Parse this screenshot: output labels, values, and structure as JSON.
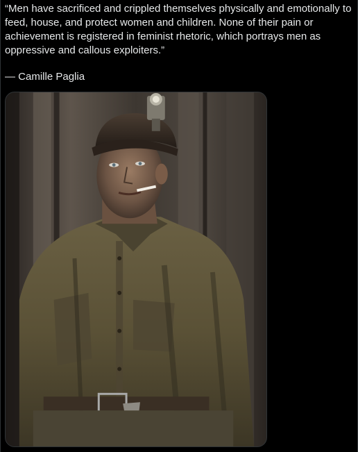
{
  "post": {
    "quote_text": "“Men have sacrificed and crippled themselves physically and emotionally to feed, house, and protect women and children. None of their pain or achievement is registered in feminist rhetoric, which portrays men as oppressive and callous exploiters.”",
    "attribution": "— Camille Paglia"
  },
  "media": {
    "subject": "colorized photograph of a young coal miner with headlamp cap and cigarette",
    "colors": {
      "background": "#000000",
      "text": "#e7e9ea",
      "border": "#2f3336"
    }
  }
}
